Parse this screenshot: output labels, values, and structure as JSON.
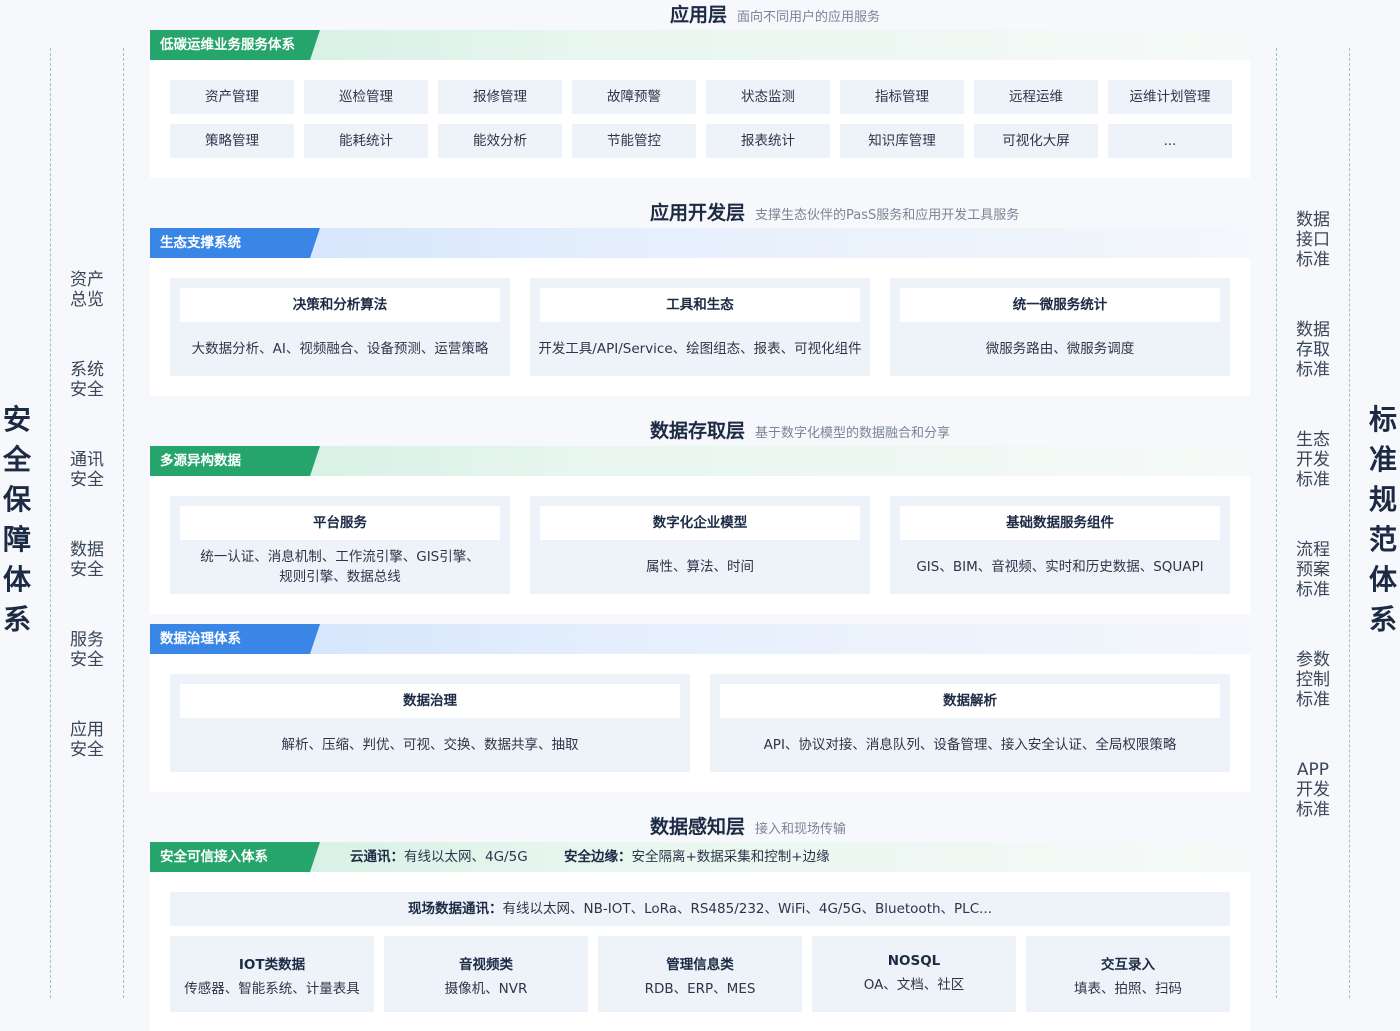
{
  "left_side": {
    "title_chars": [
      "安",
      "全",
      "保",
      "障",
      "体",
      "系"
    ],
    "items": [
      [
        "资产",
        "总览"
      ],
      [
        "系统",
        "安全"
      ],
      [
        "通讯",
        "安全"
      ],
      [
        "数据",
        "安全"
      ],
      [
        "服务",
        "安全"
      ],
      [
        "应用",
        "安全"
      ]
    ]
  },
  "right_side": {
    "title_chars": [
      "标",
      "准",
      "规",
      "范",
      "体",
      "系"
    ],
    "items": [
      [
        "数据",
        "接口",
        "标准"
      ],
      [
        "数据",
        "存取",
        "标准"
      ],
      [
        "生态",
        "开发",
        "标准"
      ],
      [
        "流程",
        "预案",
        "标准"
      ],
      [
        "参数",
        "控制",
        "标准"
      ],
      [
        "APP",
        "开发",
        "标准"
      ]
    ]
  },
  "app_layer": {
    "title": "应用层",
    "subtitle": "面向不同用户的应用服务",
    "band_label": "低碳运维业务服务体系",
    "items": [
      "资产管理",
      "巡检管理",
      "报修管理",
      "故障预警",
      "状态监测",
      "指标管理",
      "远程运维",
      "运维计划管理",
      "策略管理",
      "能耗统计",
      "能效分析",
      "节能管控",
      "报表统计",
      "知识库管理",
      "可视化大屏",
      "..."
    ]
  },
  "dev_layer": {
    "title": "应用开发层",
    "subtitle": "支撑生态伙伴的PasS服务和应用开发工具服务",
    "band_label": "生态支撑系统",
    "cards": [
      {
        "title": "决策和分析算法",
        "desc": "大数据分析、AI、视频融合、设备预测、运营策略"
      },
      {
        "title": "工具和生态",
        "desc": "开发工具/API/Service、绘图组态、报表、可视化组件"
      },
      {
        "title": "统一微服务统计",
        "desc": "微服务路由、微服务调度"
      }
    ]
  },
  "data_layer": {
    "title": "数据存取层",
    "subtitle": "基于数字化模型的数据融合和分享",
    "band_label": "多源异构数据",
    "cards": [
      {
        "title": "平台服务",
        "desc_lines": [
          "统一认证、消息机制、工作流引擎、GIS引擎、",
          "规则引擎、数据总线"
        ]
      },
      {
        "title": "数字化企业模型",
        "desc_lines": [
          "属性、算法、时间"
        ]
      },
      {
        "title": "基础数据服务组件",
        "desc_lines": [
          "GIS、BIM、音视频、实时和历史数据、SQUAPI"
        ]
      }
    ],
    "governance": {
      "band_label": "数据治理体系",
      "cards": [
        {
          "title": "数据治理",
          "desc": "解析、压缩、判优、可视、交换、数据共享、抽取"
        },
        {
          "title": "数据解析",
          "desc": "API、协议对接、消息队列、设备管理、接入安全认证、全局权限策略"
        }
      ]
    }
  },
  "perception_layer": {
    "title": "数据感知层",
    "subtitle": "接入和现场传输",
    "band_label": "安全可信接入体系",
    "cloud_label": "云通讯：",
    "cloud_value": "有线以太网、4G/5G",
    "edge_label": "安全边缘：",
    "edge_value": "安全隔离+数据采集和控制+边缘",
    "field_label": "现场数据通讯：",
    "field_value": "有线以太网、NB-IOT、LoRa、RS485/232、WiFi、4G/5G、Bluetooth、PLC...",
    "cards": [
      {
        "title": "IOT类数据",
        "desc": "传感器、智能系统、计量表具"
      },
      {
        "title": "音视频类",
        "desc": "摄像机、NVR"
      },
      {
        "title": "管理信息类",
        "desc": "RDB、ERP、MES"
      },
      {
        "title": "NOSQL",
        "desc": "OA、文档、社区"
      },
      {
        "title": "交互录入",
        "desc": "填表、拍照、扫码"
      }
    ]
  },
  "colors": {
    "green_accent": "#25a46c",
    "blue_accent": "#3a86e6",
    "title_text": "#1d2a44"
  }
}
